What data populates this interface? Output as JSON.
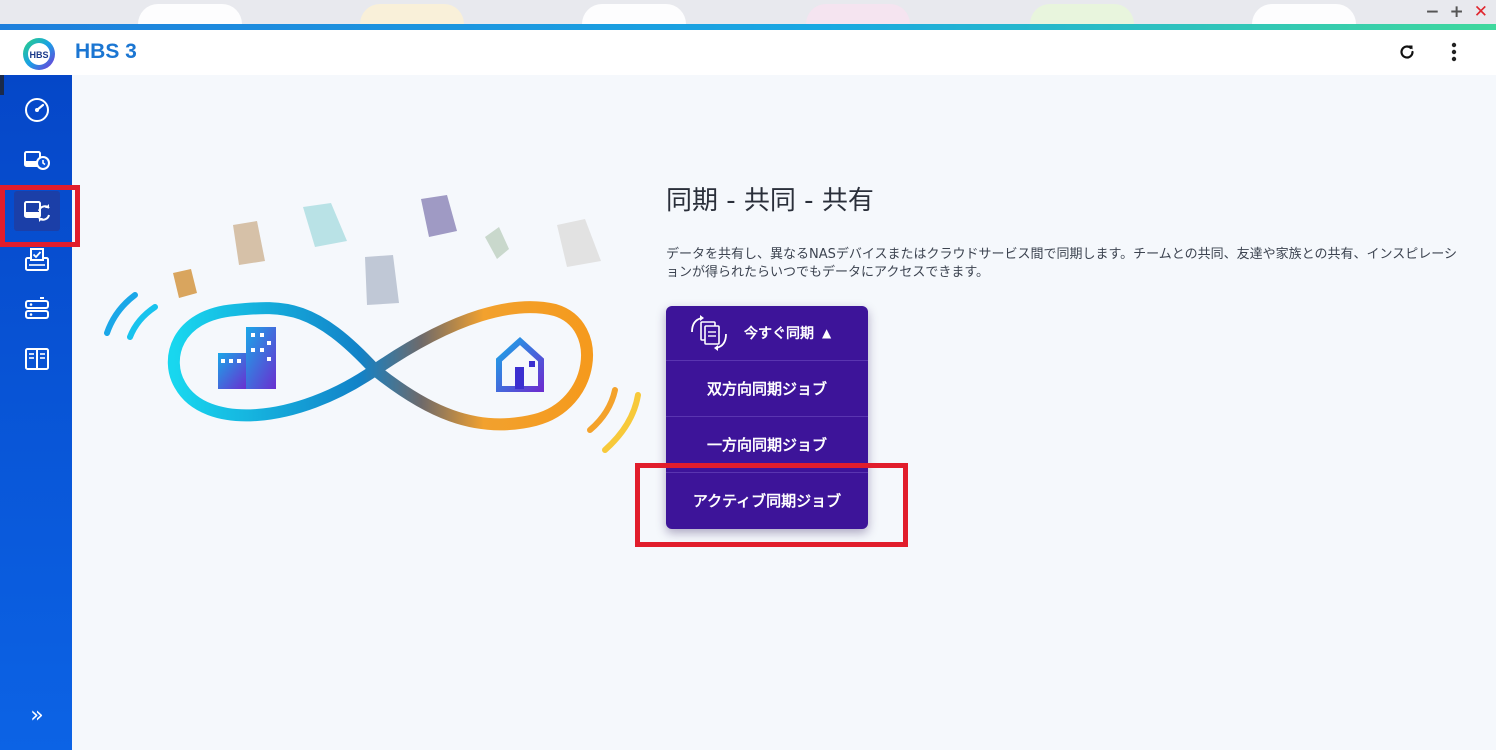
{
  "window": {
    "minimize_label": "−",
    "maximize_label": "+",
    "close_label": "✕"
  },
  "header": {
    "app_title": "HBS 3",
    "logo_text": "HBS",
    "refresh_icon": "refresh-icon",
    "more_icon": "more-vertical-icon"
  },
  "sidebar": {
    "items": [
      {
        "id": "overview",
        "icon": "speedometer-icon"
      },
      {
        "id": "backup-restore",
        "icon": "backup-clock-icon"
      },
      {
        "id": "sync",
        "icon": "sync-icon",
        "active": true
      },
      {
        "id": "jobs",
        "icon": "job-check-icon"
      },
      {
        "id": "storage-spaces",
        "icon": "storage-icon"
      },
      {
        "id": "services",
        "icon": "services-icon"
      }
    ],
    "expand_label": "»"
  },
  "main": {
    "title": "同期 - 共同 - 共有",
    "description": "データを共有し、異なるNASデバイスまたはクラウドサービス間で同期します。チームとの共同、友達や家族との共有、インスピレーションが得られたらいつでもデータにアクセスできます。",
    "sync_menu": {
      "head_label": "今すぐ同期",
      "caret": "▲",
      "items": [
        {
          "label": "双方向同期ジョブ"
        },
        {
          "label": "一方向同期ジョブ"
        },
        {
          "label": "アクティブ同期ジョブ"
        }
      ]
    }
  },
  "colors": {
    "sidebar": "#0c63e5",
    "menu_bg": "#3d1499",
    "highlight": "#e11d2c",
    "title_blue": "#1b76d2"
  }
}
